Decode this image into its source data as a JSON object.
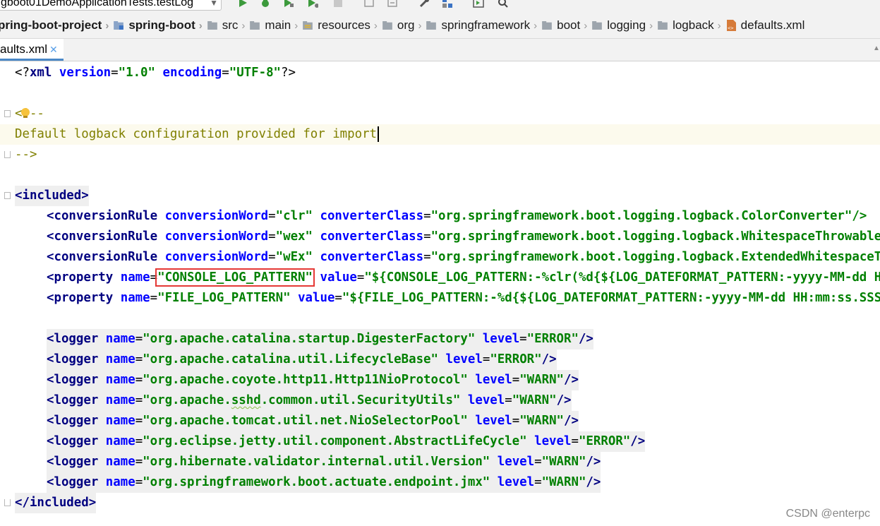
{
  "toolbar": {
    "run_config_label": "gboot01DemoApplicationTests.testLog",
    "icons": [
      "run-icon",
      "debug-icon",
      "coverage-icon",
      "profile-icon",
      "stop-icon",
      "build-icon",
      "update-icon",
      "settings-icon",
      "structure-icon",
      "terminal-icon",
      "search-icon"
    ]
  },
  "breadcrumb": {
    "items": [
      {
        "label": "pring-boot-project",
        "bold": true
      },
      {
        "label": "spring-boot",
        "bold": true
      },
      {
        "label": "src"
      },
      {
        "label": "main"
      },
      {
        "label": "resources"
      },
      {
        "label": "org"
      },
      {
        "label": "springframework"
      },
      {
        "label": "boot"
      },
      {
        "label": "logging"
      },
      {
        "label": "logback"
      },
      {
        "label": "defaults.xml"
      }
    ]
  },
  "tabs": [
    {
      "label": "aults.xml"
    }
  ],
  "editor": {
    "l1": {
      "open": "<?",
      "kw": "xml",
      "a1": "version",
      "eq1": "=",
      "v1": "\"1.0\"",
      "a2": "encoding",
      "eq2": "=",
      "v2": "\"UTF-8\"",
      "close": "?>"
    },
    "l3": {
      "text": "<!--"
    },
    "l4": {
      "text": "Default logback configuration provided for import"
    },
    "l5": {
      "text": "-->"
    },
    "included_open": "included",
    "included_close": "included",
    "conversion_rules": [
      {
        "tag": "conversionRule",
        "a1": "conversionWord",
        "v1": "\"clr\"",
        "a2": "converterClass",
        "v2": "\"org.springframework.boot.logging.logback.ColorConverter\"/>"
      },
      {
        "tag": "conversionRule",
        "a1": "conversionWord",
        "v1": "\"wex\"",
        "a2": "converterClass",
        "v2": "\"org.springframework.boot.logging.logback.WhitespaceThrowableProxyConverter\"/>"
      },
      {
        "tag": "conversionRule",
        "a1": "conversionWord",
        "v1": "\"wEx\"",
        "a2": "converterClass",
        "v2": "\"org.springframework.boot.logging.logback.ExtendedWhitespaceThrowableProxyConverter\"/>"
      }
    ],
    "properties": [
      {
        "tag": "property",
        "a1": "name",
        "v1": "\"CONSOLE_LOG_PATTERN\"",
        "a2": "value",
        "v2": "\"${CONSOLE_LOG_PATTERN:-%clr(%d{${LOG_DATEFORMAT_PATTERN:-yyyy-MM-dd HH:mm:ss.SSS}}){faint}"
      },
      {
        "tag": "property",
        "a1": "name",
        "v1": "\"FILE_LOG_PATTERN\"",
        "a2": "value",
        "v2": "\"${FILE_LOG_PATTERN:-%d{${LOG_DATEFORMAT_PATTERN:-yyyy-MM-dd HH:mm:ss.SSS}}"
      }
    ],
    "loggers": [
      {
        "name": "\"org.apache.catalina.startup.DigesterFactory\"",
        "level": "\"ERROR\""
      },
      {
        "name": "\"org.apache.catalina.util.LifecycleBase\"",
        "level": "\"ERROR\""
      },
      {
        "name": "\"org.apache.coyote.http11.Http11NioProtocol\"",
        "level": "\"WARN\""
      },
      {
        "name_pre": "\"org.apache.",
        "name_squig": "sshd",
        "name_post": ".common.util.SecurityUtils\"",
        "level": "\"WARN\""
      },
      {
        "name": "\"org.apache.tomcat.util.net.NioSelectorPool\"",
        "level": "\"WARN\""
      },
      {
        "name": "\"org.eclipse.jetty.util.component.AbstractLifeCycle\"",
        "level": "\"ERROR\""
      },
      {
        "name": "\"org.hibernate.validator.internal.util.Version\"",
        "level": "\"WARN\""
      },
      {
        "name": "\"org.springframework.boot.actuate.endpoint.jmx\"",
        "level": "\"WARN\""
      }
    ],
    "logger_tag": "logger",
    "logger_attr_name": "name",
    "logger_attr_level": "level"
  },
  "watermark": "CSDN @enterpc"
}
